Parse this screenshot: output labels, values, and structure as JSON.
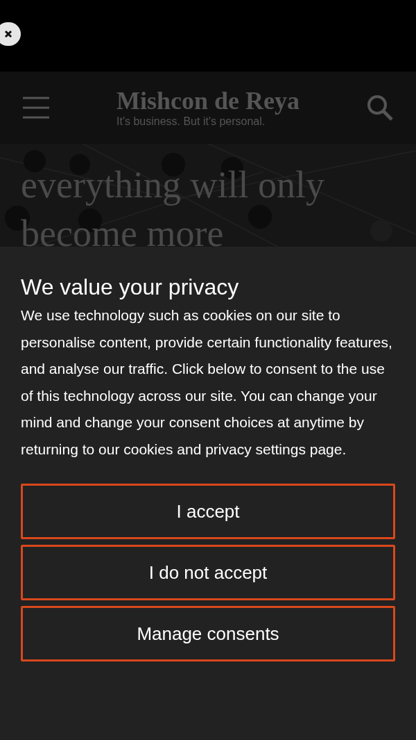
{
  "header": {
    "logo": "Mishcon de Reya",
    "tagline": "It's business. But it's personal."
  },
  "hero": {
    "lines": [
      "everything will only",
      "become more"
    ]
  },
  "consent": {
    "title": "We value your privacy",
    "body": "We use technology such as cookies on our site to personalise content, provide certain functionality features, and analyse our traffic. Click below to consent to the use of this technology across our site. You can change your mind and change your consent choices at anytime by returning to our cookies and privacy settings page.",
    "buttons": [
      "I accept",
      "I do not accept",
      "Manage consents"
    ]
  }
}
